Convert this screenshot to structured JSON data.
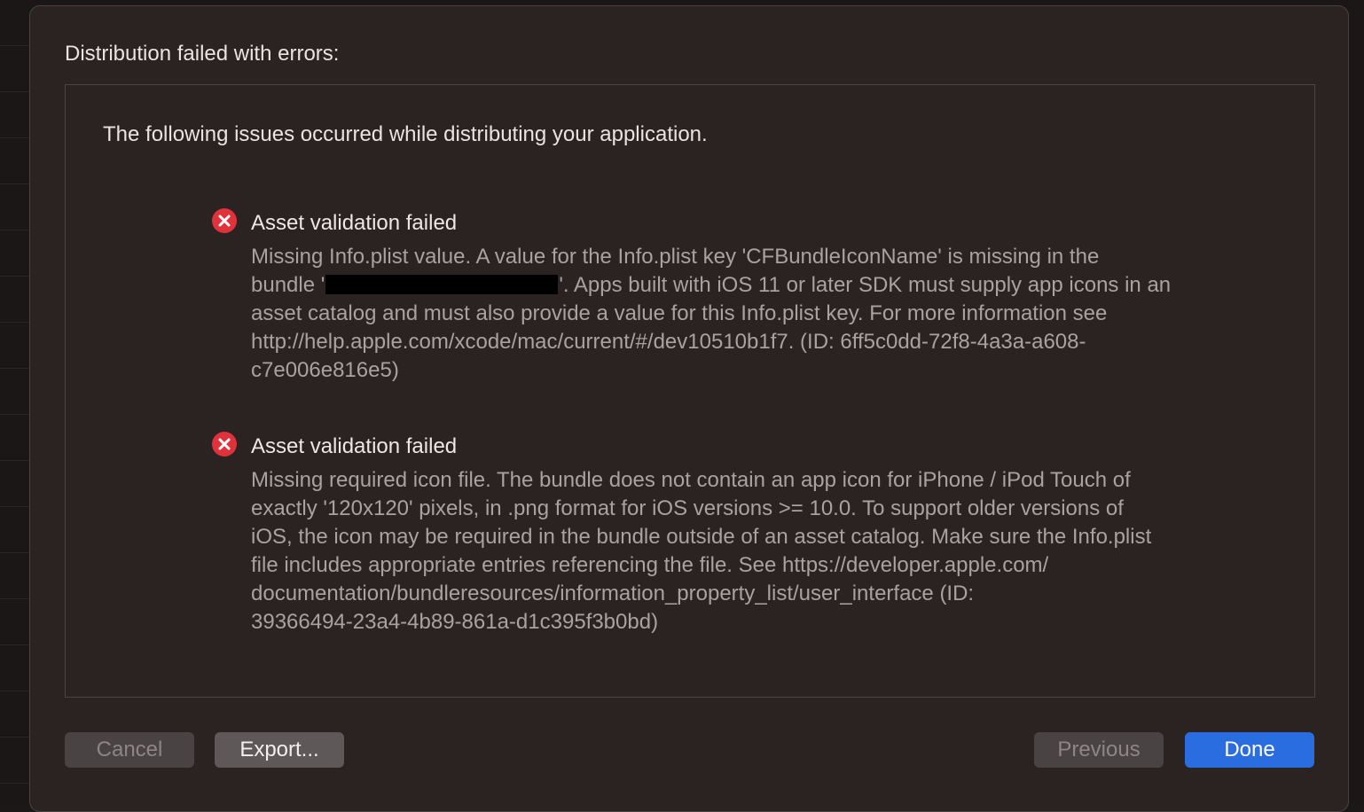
{
  "dialog": {
    "title": "Distribution failed with errors:",
    "intro": "The following issues occurred while distributing your application."
  },
  "issues": [
    {
      "title": "Asset validation failed",
      "lines": [
        "Missing Info.plist value. A value for the Info.plist key 'CFBundleIconName' is missing in the",
        "bundle '",
        "'. Apps built with iOS 11 or later SDK must supply app icons in an",
        "asset catalog and must also provide a value for this Info.plist key. For more information see",
        "http://help.apple.com/xcode/mac/current/#/dev10510b1f7. (ID: 6ff5c0dd-72f8-4a3a-a608-",
        "c7e006e816e5)"
      ]
    },
    {
      "title": "Asset validation failed",
      "lines": [
        "Missing required icon file. The bundle does not contain an app icon for iPhone / iPod Touch of",
        "exactly '120x120' pixels, in .png format for iOS versions >= 10.0. To support older versions of",
        "iOS, the icon may be required in the bundle outside of an asset catalog. Make sure the Info.plist",
        "file includes appropriate entries referencing the file. See https://developer.apple.com/",
        "documentation/bundleresources/information_property_list/user_interface (ID:",
        "39366494-23a4-4b89-861a-d1c395f3b0bd)"
      ]
    }
  ],
  "buttons": {
    "cancel": "Cancel",
    "export": "Export...",
    "previous": "Previous",
    "done": "Done"
  },
  "icons": {
    "error": "error-icon"
  },
  "colors": {
    "error_red": "#e0323a",
    "done_blue": "#2a6de0",
    "sheet_background": "#2b2222"
  }
}
